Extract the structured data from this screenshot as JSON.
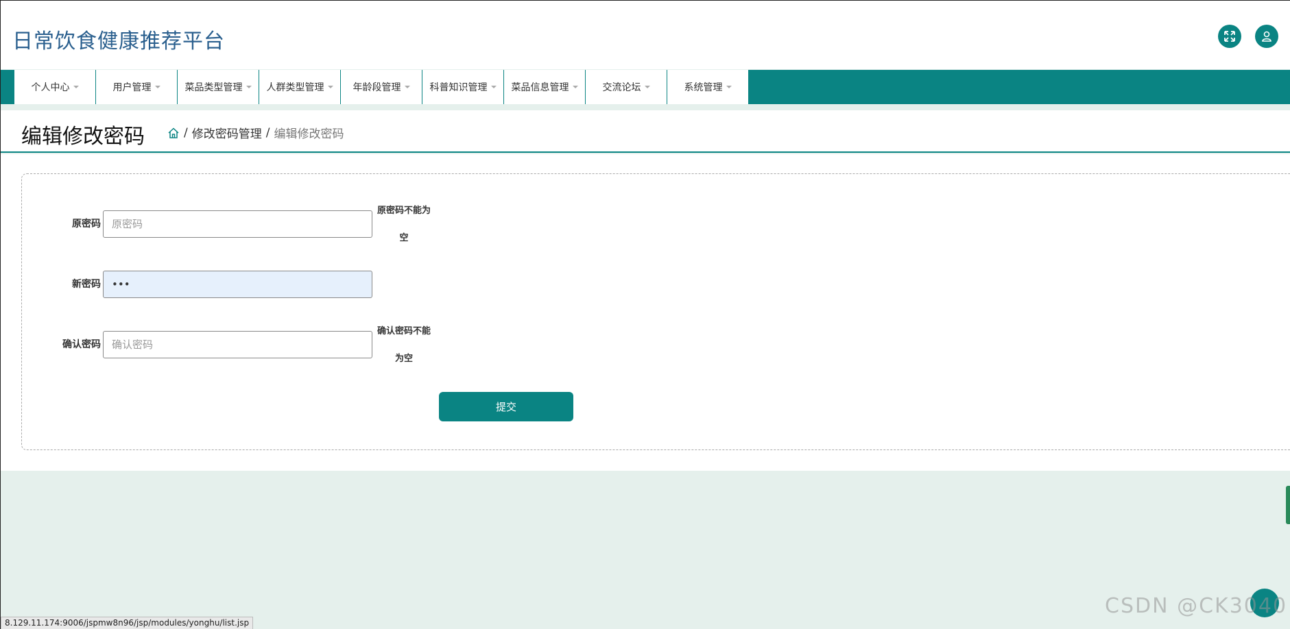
{
  "header": {
    "app_title": "日常饮食健康推荐平台"
  },
  "nav": {
    "items": [
      {
        "label": "个人中心"
      },
      {
        "label": "用户管理"
      },
      {
        "label": "菜品类型管理"
      },
      {
        "label": "人群类型管理"
      },
      {
        "label": "年龄段管理"
      },
      {
        "label": "科普知识管理"
      },
      {
        "label": "菜品信息管理"
      },
      {
        "label": "交流论坛"
      },
      {
        "label": "系统管理"
      }
    ]
  },
  "page": {
    "title": "编辑修改密码",
    "breadcrumb": {
      "separator": "/",
      "parent": "修改密码管理",
      "current": "编辑修改密码"
    }
  },
  "form": {
    "old_password": {
      "label": "原密码",
      "placeholder": "原密码",
      "value": "",
      "error_line1": "原密码不能为",
      "error_line2": "空"
    },
    "new_password": {
      "label": "新密码",
      "placeholder": "",
      "value": "•••"
    },
    "confirm_password": {
      "label": "确认密码",
      "placeholder": "确认密码",
      "value": "",
      "error_line1": "确认密码不能",
      "error_line2": "为空"
    },
    "submit_label": "提交"
  },
  "status_bar": {
    "url": "8.129.11.174:9006/jspmw8n96/jsp/modules/yonghu/list.jsp"
  },
  "watermark": "CSDN @CK3040",
  "colors": {
    "accent": "#0a8483",
    "title": "#2a5f8e",
    "page_bg": "#e5f0ec"
  }
}
